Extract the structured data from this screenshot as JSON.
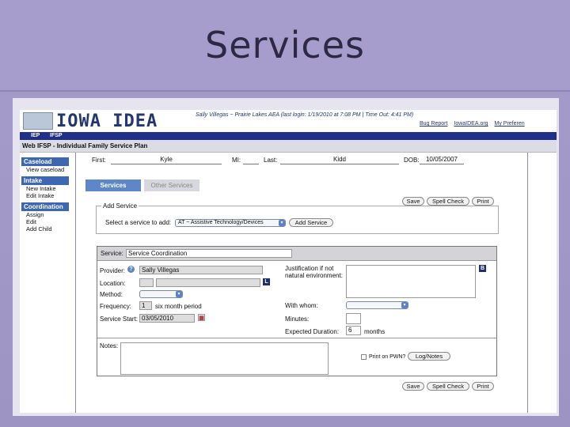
{
  "slide": {
    "title": "Services"
  },
  "app": {
    "logo": "IOWA IDEA",
    "session": "Sally Villegas ~ Prairie Lakes AEA   (last login: 1/19/2010 at 7:08 PM  |  Time Out: 4:41 PM)",
    "top_links": [
      "Bug Report",
      "IowaIDEA.org",
      "My Preferen"
    ],
    "nav": [
      "IEP",
      "IFSP"
    ],
    "page_title": "Web IFSP - Individual Family Service Plan"
  },
  "sidebar": {
    "groups": [
      {
        "label": "Caseload",
        "items": [
          "View caseload"
        ]
      },
      {
        "label": "Intake",
        "items": [
          "New Intake",
          "Edit Intake"
        ]
      },
      {
        "label": "Coordination",
        "items": [
          "Assign",
          "Edit",
          "Add Child"
        ]
      }
    ]
  },
  "child": {
    "first_label": "First:",
    "first": "Kyle",
    "mi_label": "MI:",
    "mi": "",
    "last_label": "Last:",
    "last": "Kidd",
    "dob_label": "DOB:",
    "dob": "10/05/2007"
  },
  "tabs": [
    "Services",
    "Other Services"
  ],
  "actions": {
    "save": "Save",
    "spell": "Spell Check",
    "print": "Print"
  },
  "add_service": {
    "legend": "Add Service",
    "prompt": "Select a service to add:",
    "selected": "AT ~ Assistive Technology/Devices",
    "button": "Add Service"
  },
  "service": {
    "label": "Service:",
    "value": "Service Coordination",
    "provider_label": "Provider:",
    "provider": "Sally Villegas",
    "location_label": "Location:",
    "method_label": "Method:",
    "frequency_label": "Frequency:",
    "frequency": "1",
    "frequency_unit": "six month period",
    "start_label": "Service Start:",
    "start": "03/05/2010",
    "justification_label_1": "Justification if not",
    "justification_label_2": "natural environment:",
    "with_whom_label": "With whom:",
    "minutes_label": "Minutes:",
    "duration_label": "Expected Duration:",
    "duration": "6",
    "duration_unit": "months",
    "notes_label": "Notes:",
    "pwn_label": "Print on PWN?",
    "log_button": "Log/Notes",
    "location_icon": "L",
    "justification_icon": "B"
  },
  "colors": {
    "slide_bg": "#a59bc9",
    "nav_bg": "#1f2f8a",
    "tab_active": "#5d87c6",
    "sidebar_header": "#3d67b3"
  }
}
